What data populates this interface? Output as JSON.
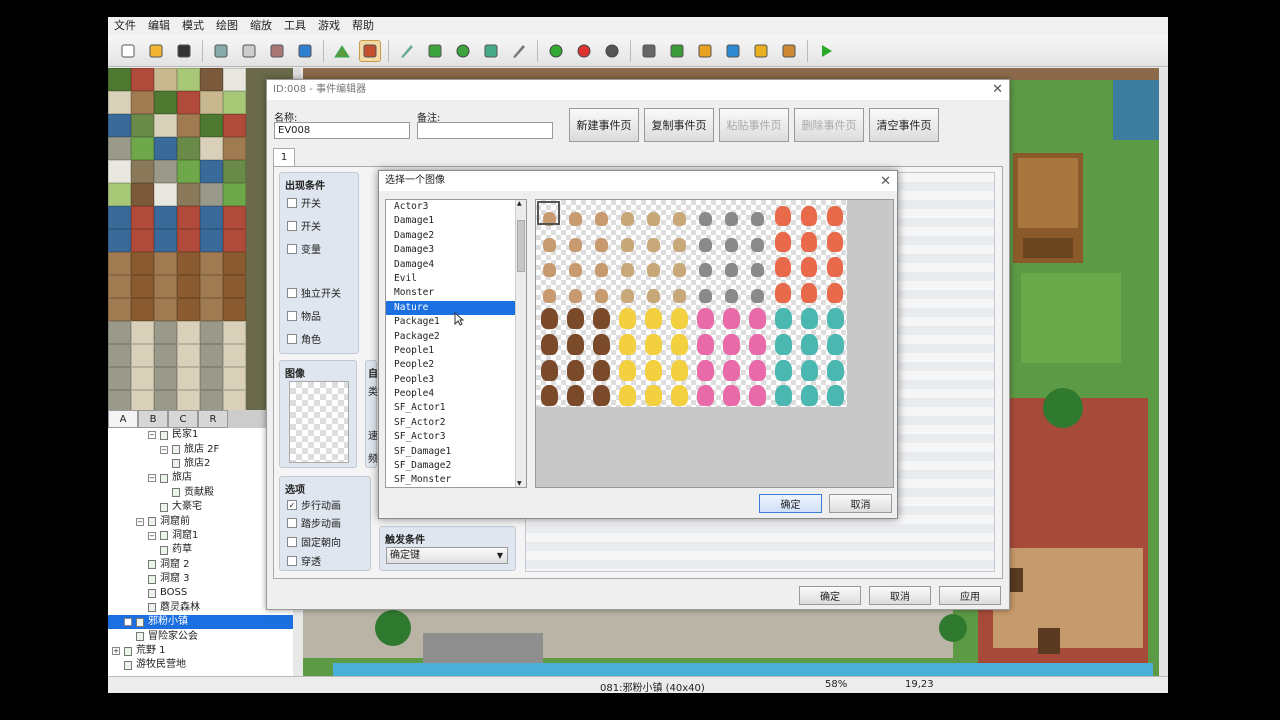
{
  "menu": [
    "文件",
    "编辑",
    "模式",
    "绘图",
    "缩放",
    "工具",
    "游戏",
    "帮助"
  ],
  "toolbar_icons": [
    "new-icon",
    "open-folder-icon",
    "save-icon",
    "cut-icon",
    "copy-icon",
    "paste-icon",
    "undo-icon",
    "map-mode-icon",
    "event-mode-icon",
    "pencil-icon",
    "rectangle-icon",
    "ellipse-icon",
    "fill-icon",
    "shadow-pen-icon",
    "zoom-in-icon",
    "zoom-out-icon",
    "zoom-actual-icon",
    "database-icon",
    "plugin-icon",
    "sound-icon",
    "event-search-icon",
    "resource-manager-icon",
    "character-generator-icon",
    "playtest-icon"
  ],
  "tile_tabs": [
    "A",
    "B",
    "C",
    "R"
  ],
  "map_tree": [
    {
      "label": "民家1",
      "indent": 3,
      "pm": "−"
    },
    {
      "label": "旅店 2F",
      "indent": 4,
      "pm": "−"
    },
    {
      "label": "旅店2",
      "indent": 5
    },
    {
      "label": "旅店",
      "indent": 3,
      "pm": "−"
    },
    {
      "label": "贡献殿",
      "indent": 5
    },
    {
      "label": "大豪宅",
      "indent": 4
    },
    {
      "label": "洞窟前",
      "indent": 2,
      "pm": "−"
    },
    {
      "label": "洞窟1",
      "indent": 3,
      "pm": "−"
    },
    {
      "label": "药草",
      "indent": 4
    },
    {
      "label": "洞窟 2",
      "indent": 3
    },
    {
      "label": "洞窟 3",
      "indent": 3
    },
    {
      "label": "BOSS",
      "indent": 3
    },
    {
      "label": "蘑灵森林",
      "indent": 3
    },
    {
      "label": "邪粉小镇",
      "indent": 1,
      "pm": "−",
      "selected": true
    },
    {
      "label": "冒险家公会",
      "indent": 2
    },
    {
      "label": "荒野 1",
      "indent": 0,
      "pm": "+"
    },
    {
      "label": "游牧民营地",
      "indent": 1
    }
  ],
  "status": {
    "map": "081:邪粉小镇 (40x40)",
    "zoom": "58%",
    "coords": "19,23"
  },
  "event_editor": {
    "title": "ID:008 - 事件编辑器",
    "name_label": "名称:",
    "name_value": "EV008",
    "note_label": "备注:",
    "note_value": "",
    "buttons": [
      "新建事件页",
      "复制事件页",
      "粘贴事件页",
      "删除事件页",
      "清空事件页"
    ],
    "tab": "1",
    "conditions_title": "出现条件",
    "conditions": [
      "开关",
      "开关",
      "变量",
      "独立开关",
      "物品",
      "角色"
    ],
    "image_title": "图像",
    "options_title": "选项",
    "options": [
      {
        "label": "步行动画",
        "checked": true
      },
      {
        "label": "踏步动画",
        "checked": false
      },
      {
        "label": "固定朝向",
        "checked": false
      },
      {
        "label": "穿透",
        "checked": false
      }
    ],
    "trigger_title": "触发条件",
    "trigger_value": "确定键",
    "partial_text": [
      "自",
      "类",
      "速",
      "频"
    ],
    "ok": "确定",
    "cancel": "取消",
    "apply": "应用"
  },
  "image_picker": {
    "title": "选择一个图像",
    "items": [
      "Actor3",
      "Damage1",
      "Damage2",
      "Damage3",
      "Damage4",
      "Evil",
      "Monster",
      "Nature",
      "Package1",
      "Package2",
      "People1",
      "People2",
      "People3",
      "People4",
      "SF_Actor1",
      "SF_Actor2",
      "SF_Actor3",
      "SF_Damage1",
      "SF_Damage2",
      "SF_Monster"
    ],
    "selected": "Nature",
    "ok": "确定",
    "cancel": "取消"
  },
  "colors": {
    "selection": "#1b6fe0",
    "grass": "#4f8f3a",
    "panel": "#dfe6ef"
  }
}
